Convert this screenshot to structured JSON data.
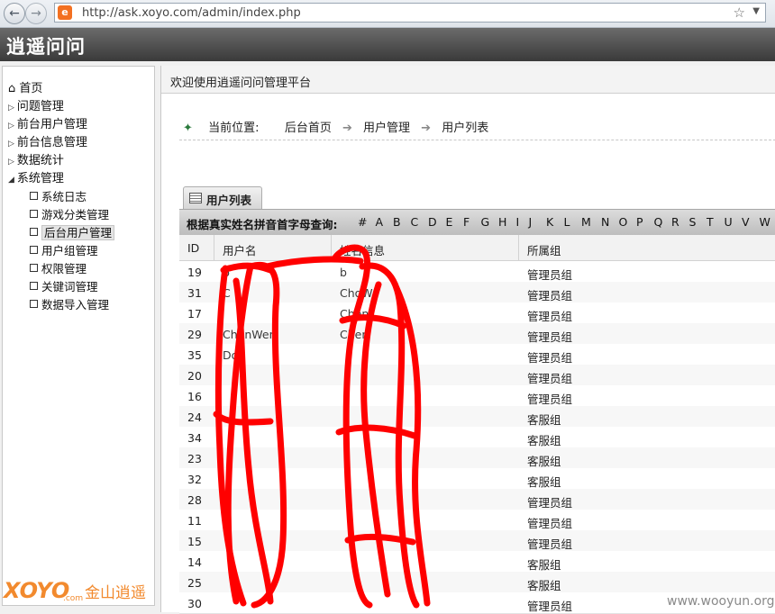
{
  "browser": {
    "url": "http://ask.xoyo.com/admin/index.php",
    "site_icon": "e"
  },
  "app": {
    "title": "逍遥问问"
  },
  "sidebar": {
    "items": [
      {
        "label": "首页",
        "icon": "home-icon"
      },
      {
        "label": "问题管理",
        "icon": "arrow-right-icon"
      },
      {
        "label": "前台用户管理",
        "icon": "arrow-right-icon"
      },
      {
        "label": "前台信息管理",
        "icon": "arrow-right-icon"
      },
      {
        "label": "数据统计",
        "icon": "arrow-right-icon"
      },
      {
        "label": "系统管理",
        "icon": "arrow-down-icon"
      }
    ],
    "subitems": [
      {
        "label": "系统日志"
      },
      {
        "label": "游戏分类管理"
      },
      {
        "label": "后台用户管理"
      },
      {
        "label": "用户组管理"
      },
      {
        "label": "权限管理"
      },
      {
        "label": "关键词管理"
      },
      {
        "label": "数据导入管理"
      }
    ],
    "logo_text": "XOYO",
    "logo_cn": "金山逍遥",
    "logo_com": ".com"
  },
  "main": {
    "welcome": "欢迎使用逍遥问问管理平台",
    "breadcrumb": {
      "label": "当前位置:",
      "items": [
        "后台首页",
        "用户管理",
        "用户列表"
      ],
      "sep": "➔"
    },
    "tab_label": "用户列表",
    "letter_filter": {
      "label": "根据真实姓名拼音首字母查询:",
      "letters": [
        "#",
        "A",
        "B",
        "C",
        "D",
        "E",
        "F",
        "G",
        "H",
        "I",
        "J",
        "K",
        "L",
        "M",
        "N",
        "O",
        "P",
        "Q",
        "R",
        "S",
        "T",
        "U",
        "V",
        "W"
      ]
    },
    "columns": [
      "ID",
      "用户名",
      "姓名信息",
      "所属组"
    ],
    "rows": [
      {
        "id": "19",
        "user": "b",
        "name": "b",
        "group": "管理员组"
      },
      {
        "id": "31",
        "user": "C",
        "name": "ChoW",
        "group": "管理员组"
      },
      {
        "id": "17",
        "user": "",
        "name": "Chen",
        "group": "管理员组"
      },
      {
        "id": "29",
        "user": "ChenWen",
        "name": "Chen",
        "group": "管理员组"
      },
      {
        "id": "35",
        "user": "Don",
        "name": "",
        "group": "管理员组"
      },
      {
        "id": "20",
        "user": "",
        "name": "",
        "group": "管理员组"
      },
      {
        "id": "16",
        "user": "",
        "name": "",
        "group": "管理员组"
      },
      {
        "id": "24",
        "user": "",
        "name": "",
        "group": "客服组"
      },
      {
        "id": "34",
        "user": "",
        "name": "",
        "group": "客服组"
      },
      {
        "id": "23",
        "user": "",
        "name": "",
        "group": "客服组"
      },
      {
        "id": "32",
        "user": "",
        "name": "",
        "group": "客服组"
      },
      {
        "id": "28",
        "user": "",
        "name": "",
        "group": "管理员组"
      },
      {
        "id": "11",
        "user": "",
        "name": "",
        "group": "管理员组"
      },
      {
        "id": "15",
        "user": "",
        "name": "",
        "group": "管理员组"
      },
      {
        "id": "14",
        "user": "",
        "name": "",
        "group": "客服组"
      },
      {
        "id": "25",
        "user": "",
        "name": "",
        "group": "客服组"
      },
      {
        "id": "30",
        "user": "",
        "name": "",
        "group": "管理员组"
      }
    ]
  },
  "watermark": "www.wooyun.org",
  "colors": {
    "scribble": "#ff0000",
    "header_bg": "#4a4a4a",
    "logo": "#f28a2e"
  }
}
